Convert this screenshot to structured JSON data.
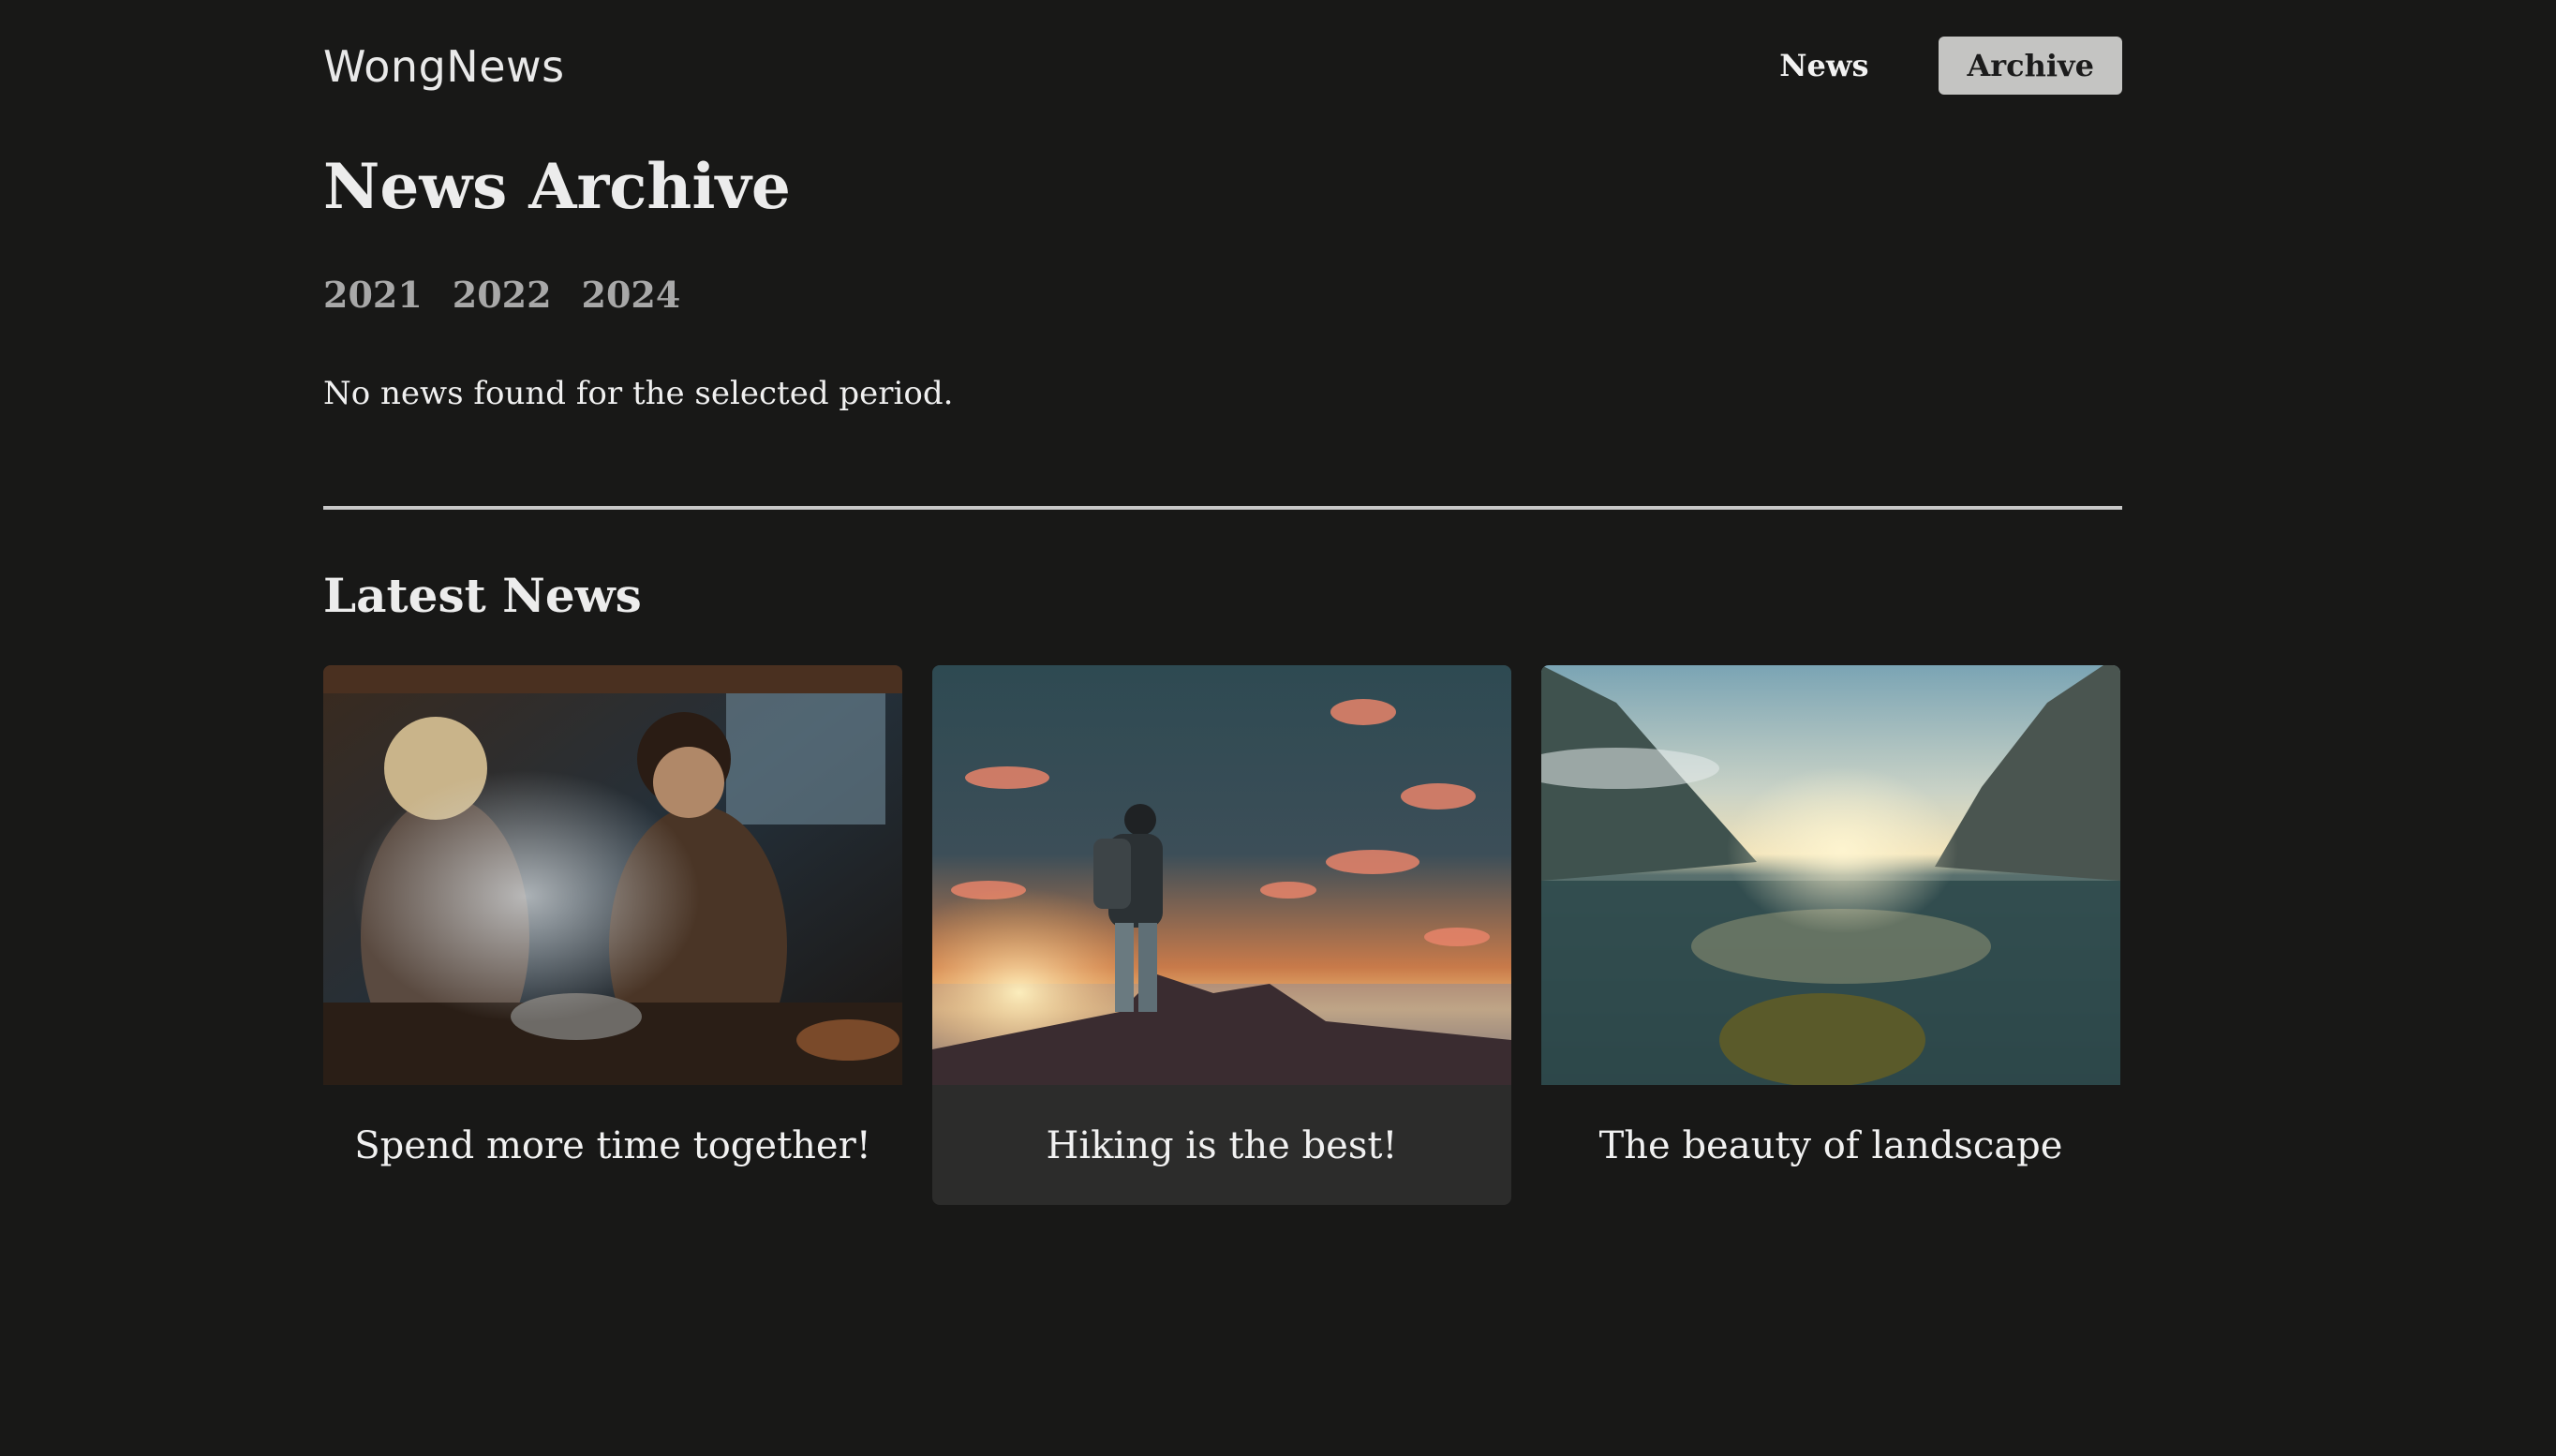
{
  "header": {
    "logo": "WongNews",
    "nav": [
      {
        "label": "News"
      },
      {
        "label": "Archive",
        "active": true
      }
    ]
  },
  "archive": {
    "title": "News Archive",
    "years": [
      "2021",
      "2022",
      "2024"
    ],
    "empty_message": "No news found for the selected period."
  },
  "latest": {
    "title": "Latest News",
    "cards": [
      {
        "caption": "Spend more time together!",
        "image": "couple-cooking-photo"
      },
      {
        "caption": "Hiking is the best!",
        "image": "hiker-sunset-photo",
        "highlighted": true
      },
      {
        "caption": "The beauty of landscape",
        "image": "mountain-lake-photo"
      }
    ]
  },
  "colors": {
    "background": "#181817",
    "active_nav_bg": "#c4c4c2",
    "card_hover_bg": "#2c2c2b",
    "year_links": "#a8a8a8"
  }
}
